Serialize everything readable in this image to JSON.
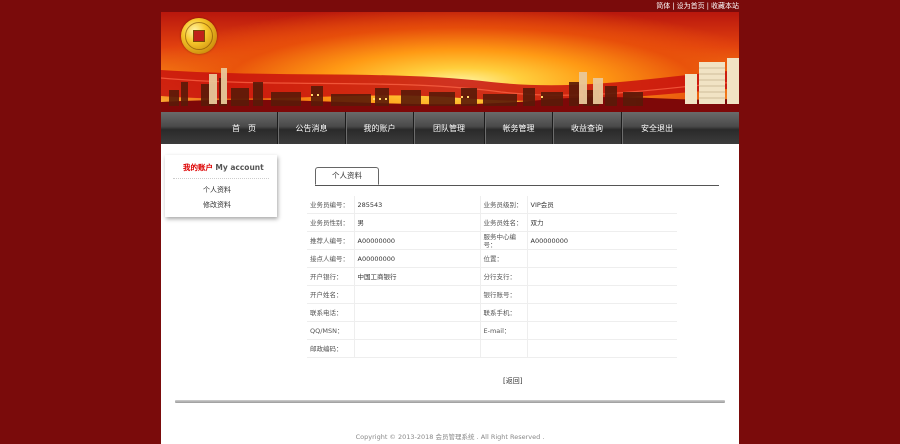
{
  "top_links": [
    "简体",
    "设为首页",
    "收藏本站"
  ],
  "nav": {
    "items": [
      "首　页",
      "公告消息",
      "我的账户",
      "团队管理",
      "帐务管理",
      "收益查询",
      "安全退出"
    ]
  },
  "sidebar": {
    "title_cn": "我的账户",
    "title_en": "My account",
    "items": [
      "个人资料",
      "修改资料"
    ]
  },
  "tab": {
    "label": "个人资料"
  },
  "info_rows": [
    {
      "l1": "业务员编号：",
      "v1": "285543",
      "l2": "业务员级别：",
      "v2": "VIP会员"
    },
    {
      "l1": "业务员性别：",
      "v1": "男",
      "l2": "业务员姓名：",
      "v2": "双力"
    },
    {
      "l1": "推荐人编号：",
      "v1": "A00000000",
      "l2": "服务中心编号：",
      "v2": "A00000000"
    },
    {
      "l1": "接点人编号：",
      "v1": "A00000000",
      "l2": "位置：",
      "v2": ""
    },
    {
      "l1": "开户银行：",
      "v1": "中国工商银行",
      "l2": "分行支行：",
      "v2": ""
    },
    {
      "l1": "开户姓名：",
      "v1": "",
      "l2": "银行账号：",
      "v2": ""
    },
    {
      "l1": "联系电话：",
      "v1": "",
      "l2": "联系手机：",
      "v2": ""
    },
    {
      "l1": "QQ/MSN：",
      "v1": "",
      "l2": "E-mail：",
      "v2": ""
    },
    {
      "l1": "邮政编码：",
      "v1": "",
      "l2": "",
      "v2": ""
    }
  ],
  "back_label": "[返回]",
  "footer": {
    "copyright": "Copyright © 2013-2018 会员管理系统 . All Right Reserved ."
  },
  "colors": {
    "page_bg": "#7a0b0b",
    "accent_red": "#dd0000",
    "nav_dark": "#3c3c3c"
  }
}
